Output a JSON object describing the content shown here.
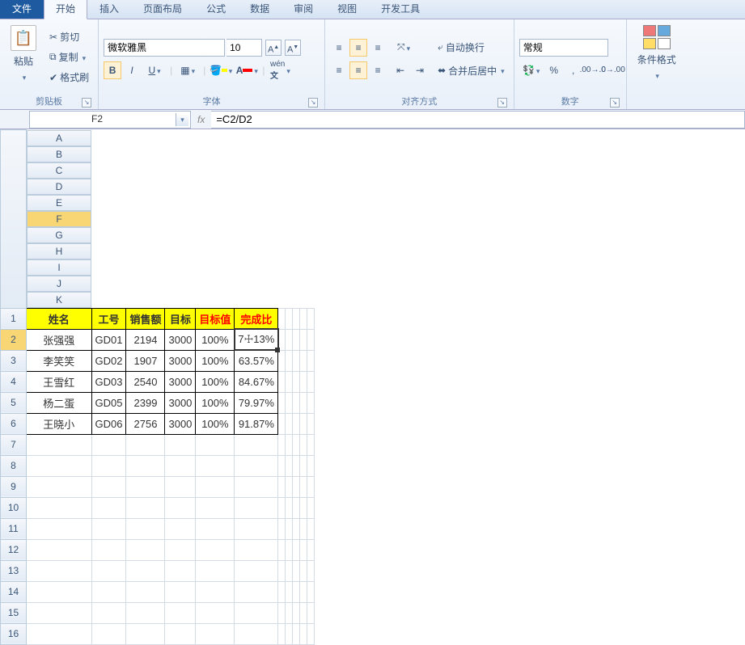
{
  "tabs": {
    "file": "文件",
    "home": "开始",
    "insert": "插入",
    "layout": "页面布局",
    "formulas": "公式",
    "data": "数据",
    "review": "审阅",
    "view": "视图",
    "dev": "开发工具"
  },
  "ribbon": {
    "clipboard": {
      "paste": "粘贴",
      "cut": "剪切",
      "copy": "复制",
      "painter": "格式刷",
      "label": "剪贴板"
    },
    "font": {
      "name": "微软雅黑",
      "size": "10",
      "label": "字体",
      "bold": "B",
      "italic": "I",
      "underline": "U"
    },
    "align": {
      "wrap": "自动换行",
      "merge": "合并后居中",
      "label": "对齐方式"
    },
    "number": {
      "format": "常规",
      "label": "数字"
    },
    "cond": {
      "label": "条件格式"
    }
  },
  "namebox": "F2",
  "formula": "=C2/D2",
  "columns": [
    "A",
    "B",
    "C",
    "D",
    "E",
    "F",
    "G",
    "H",
    "I",
    "J",
    "K"
  ],
  "headers": {
    "name": "姓名",
    "id": "工号",
    "sales": "销售额",
    "target": "目标",
    "tvalue": "目标值",
    "ratio": "完成比"
  },
  "rows": [
    {
      "name": "张强强",
      "id": "GD01",
      "sales": "2194",
      "target": "3000",
      "tvalue": "100%",
      "ratio": "73.13%",
      "ratio_display": "7☩13%"
    },
    {
      "name": "李笑笑",
      "id": "GD02",
      "sales": "1907",
      "target": "3000",
      "tvalue": "100%",
      "ratio": "63.57%"
    },
    {
      "name": "王雪红",
      "id": "GD03",
      "sales": "2540",
      "target": "3000",
      "tvalue": "100%",
      "ratio": "84.67%"
    },
    {
      "name": "杨二蛋",
      "id": "GD05",
      "sales": "2399",
      "target": "3000",
      "tvalue": "100%",
      "ratio": "79.97%"
    },
    {
      "name": "王晓小",
      "id": "GD06",
      "sales": "2756",
      "target": "3000",
      "tvalue": "100%",
      "ratio": "91.87%"
    }
  ],
  "chart_data": {
    "type": "table",
    "title": "",
    "columns": [
      "姓名",
      "工号",
      "销售额",
      "目标",
      "目标值",
      "完成比"
    ],
    "data": [
      [
        "张强强",
        "GD01",
        2194,
        3000,
        "100%",
        "73.13%"
      ],
      [
        "李笑笑",
        "GD02",
        1907,
        3000,
        "100%",
        "63.57%"
      ],
      [
        "王雪红",
        "GD03",
        2540,
        3000,
        "100%",
        "84.67%"
      ],
      [
        "杨二蛋",
        "GD05",
        2399,
        3000,
        "100%",
        "79.97%"
      ],
      [
        "王晓小",
        "GD06",
        2756,
        3000,
        "100%",
        "91.87%"
      ]
    ]
  }
}
